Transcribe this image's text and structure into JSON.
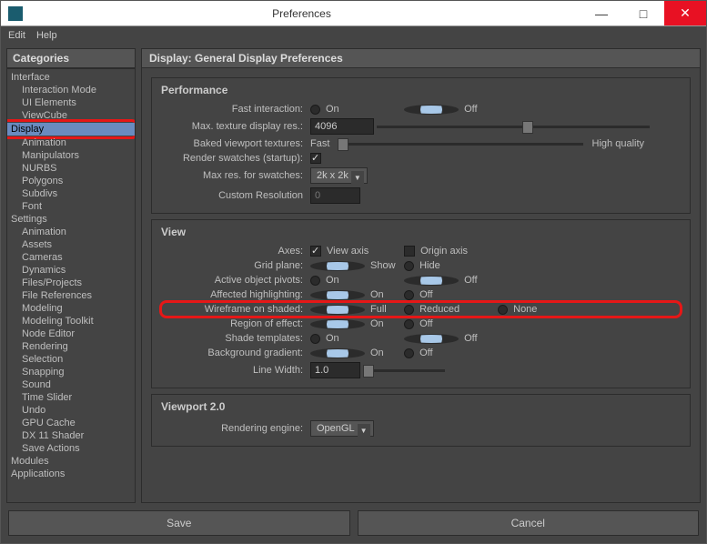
{
  "window": {
    "title": "Preferences",
    "min": "—",
    "max": "□",
    "close": "✕"
  },
  "menu": {
    "edit": "Edit",
    "help": "Help"
  },
  "categories": {
    "header": "Categories",
    "items": [
      {
        "label": "Interface",
        "level": 0
      },
      {
        "label": "Interaction Mode",
        "level": 1
      },
      {
        "label": "UI Elements",
        "level": 1
      },
      {
        "label": "ViewCube",
        "level": 1
      },
      {
        "label": "Display",
        "level": 0,
        "selected": true,
        "highlighted": true
      },
      {
        "label": "Animation",
        "level": 1
      },
      {
        "label": "Manipulators",
        "level": 1
      },
      {
        "label": "NURBS",
        "level": 1
      },
      {
        "label": "Polygons",
        "level": 1
      },
      {
        "label": "Subdivs",
        "level": 1
      },
      {
        "label": "Font",
        "level": 1
      },
      {
        "label": "Settings",
        "level": 0
      },
      {
        "label": "Animation",
        "level": 1
      },
      {
        "label": "Assets",
        "level": 1
      },
      {
        "label": "Cameras",
        "level": 1
      },
      {
        "label": "Dynamics",
        "level": 1
      },
      {
        "label": "Files/Projects",
        "level": 1
      },
      {
        "label": "File References",
        "level": 1
      },
      {
        "label": "Modeling",
        "level": 1
      },
      {
        "label": "Modeling Toolkit",
        "level": 1
      },
      {
        "label": "Node Editor",
        "level": 1
      },
      {
        "label": "Rendering",
        "level": 1
      },
      {
        "label": "Selection",
        "level": 1
      },
      {
        "label": "Snapping",
        "level": 1
      },
      {
        "label": "Sound",
        "level": 1
      },
      {
        "label": "Time Slider",
        "level": 1
      },
      {
        "label": "Undo",
        "level": 1
      },
      {
        "label": "GPU Cache",
        "level": 1
      },
      {
        "label": "DX 11 Shader",
        "level": 1
      },
      {
        "label": "Save Actions",
        "level": 1
      },
      {
        "label": "Modules",
        "level": 0
      },
      {
        "label": "Applications",
        "level": 0
      }
    ]
  },
  "content": {
    "header": "Display: General Display Preferences",
    "performance": {
      "title": "Performance",
      "fast_label": "Fast interaction:",
      "fast_on": "On",
      "fast_off": "Off",
      "maxtex_label": "Max. texture display res.:",
      "maxtex_value": "4096",
      "baked_label": "Baked viewport textures:",
      "baked_left": "Fast",
      "baked_right": "High quality",
      "swatch_label": "Render swatches (startup):",
      "swatchres_label": "Max res. for swatches:",
      "swatchres_value": "2k x 2k",
      "custom_label": "Custom Resolution",
      "custom_value": "0"
    },
    "view": {
      "title": "View",
      "axes_label": "Axes:",
      "axes_view": "View axis",
      "axes_origin": "Origin axis",
      "grid_label": "Grid plane:",
      "grid_show": "Show",
      "grid_hide": "Hide",
      "pivot_label": "Active object pivots:",
      "p_on": "On",
      "p_off": "Off",
      "affected_label": "Affected highlighting:",
      "a_on": "On",
      "a_off": "Off",
      "wireframe_label": "Wireframe on shaded:",
      "w_full": "Full",
      "w_reduced": "Reduced",
      "w_none": "None",
      "region_label": "Region of effect:",
      "r_on": "On",
      "r_off": "Off",
      "shade_label": "Shade templates:",
      "s_on": "On",
      "s_off": "Off",
      "bg_label": "Background gradient:",
      "b_on": "On",
      "b_off": "Off",
      "linew_label": "Line Width:",
      "linew_value": "1.0"
    },
    "viewport2": {
      "title": "Viewport 2.0",
      "engine_label": "Rendering engine:",
      "engine_value": "OpenGL"
    }
  },
  "buttons": {
    "save": "Save",
    "cancel": "Cancel"
  }
}
